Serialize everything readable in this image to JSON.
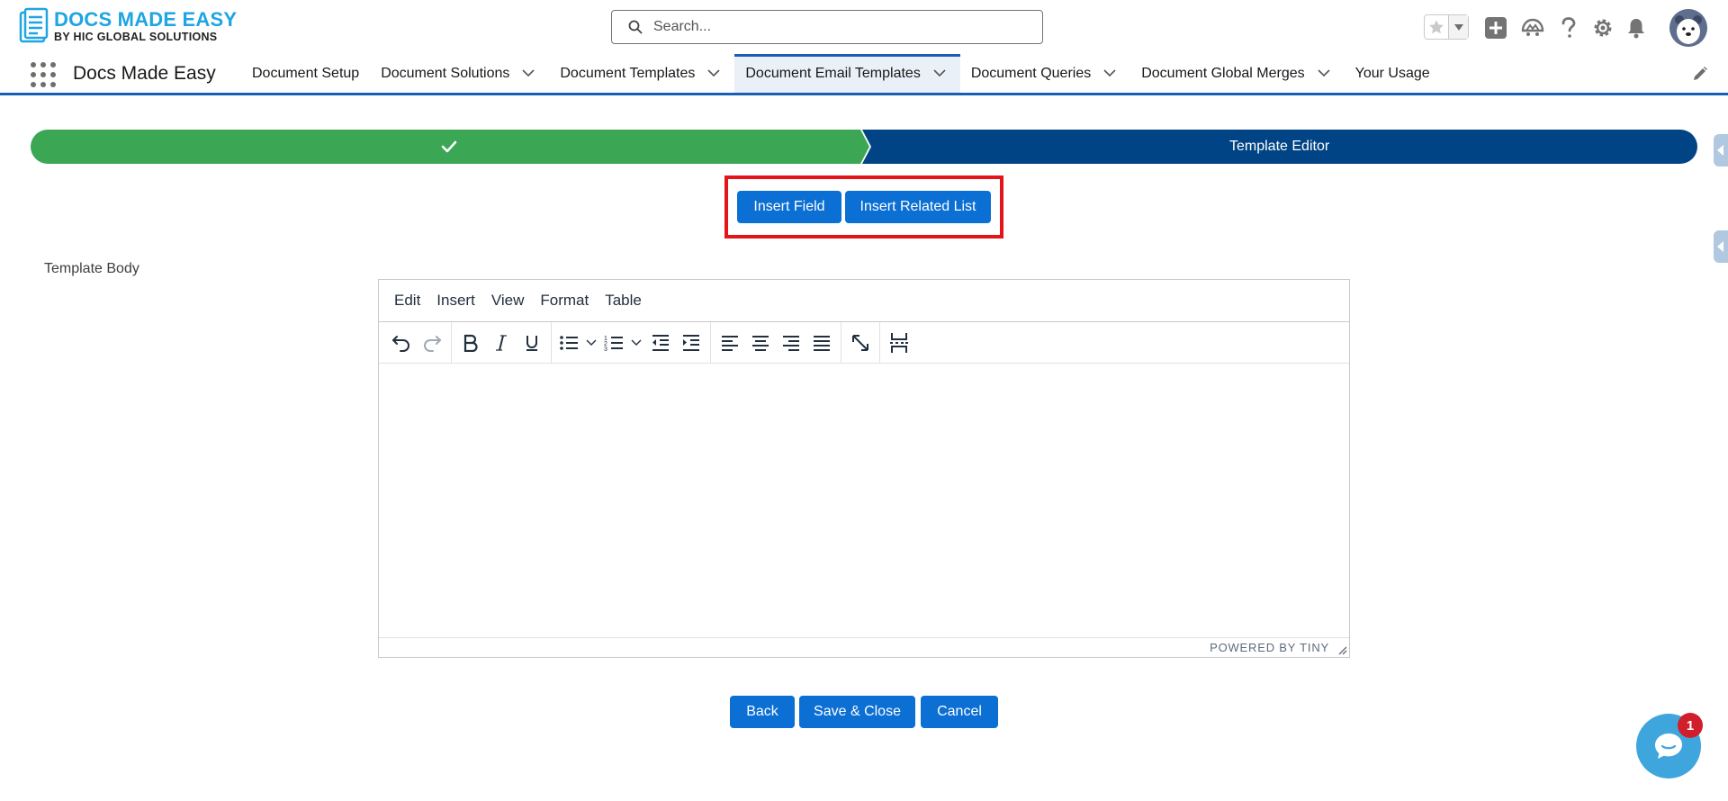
{
  "logo": {
    "main": "DOCS MADE EASY",
    "sub": "BY HIC GLOBAL SOLUTIONS"
  },
  "search": {
    "placeholder": "Search..."
  },
  "header_icons": [
    "star-icon",
    "chevron-down-icon",
    "add-icon",
    "trailhead-icon",
    "help-icon",
    "gear-icon",
    "bell-icon",
    "avatar"
  ],
  "app": {
    "name": "Docs Made Easy"
  },
  "nav": {
    "tabs": [
      {
        "label": "Document Setup",
        "has_menu": false,
        "active": false
      },
      {
        "label": "Document Solutions",
        "has_menu": true,
        "active": false
      },
      {
        "label": "Document Templates",
        "has_menu": true,
        "active": false
      },
      {
        "label": "Document Email Templates",
        "has_menu": true,
        "active": true
      },
      {
        "label": "Document Queries",
        "has_menu": true,
        "active": false
      },
      {
        "label": "Document Global Merges",
        "has_menu": true,
        "active": false
      },
      {
        "label": "Your Usage",
        "has_menu": false,
        "active": false
      }
    ]
  },
  "path": {
    "completed_step": "check-icon",
    "current_step": "Template Editor"
  },
  "actions": {
    "insert_field": "Insert Field",
    "insert_related_list": "Insert Related List"
  },
  "form": {
    "template_body_label": "Template Body"
  },
  "editor": {
    "menus": [
      "Edit",
      "Insert",
      "View",
      "Format",
      "Table"
    ],
    "toolbar_icons": [
      "undo-icon",
      "redo-icon",
      "bold-icon",
      "italic-icon",
      "underline-icon",
      "bullet-list-icon",
      "numbered-list-icon",
      "outdent-icon",
      "indent-icon",
      "align-left-icon",
      "align-center-icon",
      "align-right-icon",
      "justify-icon",
      "fullscreen-icon",
      "page-break-icon"
    ],
    "branding": "POWERED BY TINY"
  },
  "footer": {
    "back": "Back",
    "save_close": "Save & Close",
    "cancel": "Cancel"
  },
  "chat": {
    "badge_count": "1"
  },
  "colors": {
    "brand_blue": "#0b6fd3",
    "path_green": "#3ba755",
    "path_navy": "#014486",
    "highlight_red": "#e4141b",
    "logo_blue": "#1ea5e3"
  }
}
